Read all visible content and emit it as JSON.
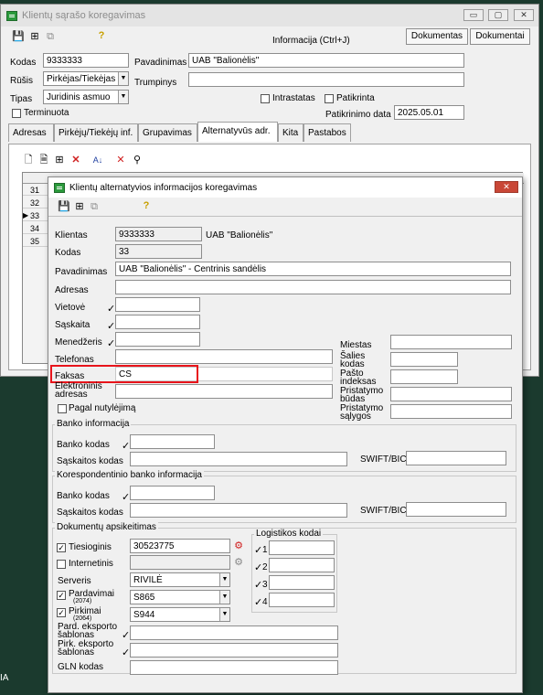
{
  "main": {
    "title": "Klientų sąrašo koregavimas",
    "wbtn_min": "▭",
    "wbtn_max": "▢",
    "wbtn_close": "✕",
    "info_label": "Informacija (Ctrl+J)",
    "btn_documents": "Dokumentas",
    "btn_documents2": "Dokumentai",
    "kodas_label": "Kodas",
    "kodas_value": "9333333",
    "pavadinimas_label": "Pavadinimas",
    "pavadinimas_value": "UAB \"Balionėlis\"",
    "rusis_label": "Rūšis",
    "rusis_value": "Pirkėjas/Tiekėjas",
    "trumpinys_label": "Trumpinys",
    "trumpinys_value": "",
    "tipas_label": "Tipas",
    "tipas_value": "Juridinis asmuo",
    "intrastatas_label": "Intrastatas",
    "patikrinta_label": "Patikrinta",
    "terminuota_label": "Terminuota",
    "patikrinimo_label": "Patikrinimo data",
    "patikrinimo_value": "2025.05.01",
    "tabs": [
      "Adresas",
      "Pirkėjų/Tiekėjų inf.",
      "Grupavimas",
      "Alternatyvūs adr.",
      "Kita",
      "Pastabos"
    ],
    "grid_rows": [
      "31",
      "32",
      "33",
      "34",
      "35"
    ],
    "grid_pointer": "▶"
  },
  "dialog": {
    "title": "Klientų alternatyvios informacijos koregavimas",
    "close": "✕",
    "klientas_label": "Klientas",
    "klientas_value": "9333333",
    "klientas_name": "UAB \"Balionėlis\"",
    "kodas_label": "Kodas",
    "kodas_value": "33",
    "pavadinimas_label": "Pavadinimas",
    "pavadinimas_value": "UAB \"Balionėlis\" - Centrinis sandėlis",
    "adresas_label": "Adresas",
    "vietove_label": "Vietovė",
    "saskaita_label": "Sąskaita",
    "menedzeris_label": "Menedžeris",
    "telefonas_label": "Telefonas",
    "faksas_label": "Faksas",
    "faksas_value": "CS",
    "email_label1": "Elektroninis",
    "email_label2": "adresas",
    "pagal_label": "Pagal nutylėjimą",
    "miestas_label": "Miestas",
    "salies_label1": "Šalies",
    "salies_label2": "kodas",
    "pasto_label1": "Pašto",
    "pasto_label2": "indeksas",
    "pristatymo_budas1": "Pristatymo",
    "pristatymo_budas2": "būdas",
    "pristatymo_salygos1": "Pristatymo",
    "pristatymo_salygos2": "sąlygos",
    "banko_group": "Banko informacija",
    "banko_kodas_label": "Banko kodas",
    "saskaitos_kodas_label": "Sąskaitos kodas",
    "swift_label": "SWIFT/BIC",
    "koresp_group": "Korespondentinio banko informacija",
    "doc_group": "Dokumentų apsikeitimas",
    "tiesioginis_label": "Tiesioginis",
    "tiesioginis_value": "30523775",
    "internetinis_label": "Internetinis",
    "serveris_label": "Serveris",
    "serveris_value": "RIVILĖ",
    "pardavimai_label": "Pardavimai",
    "pardavimai_sub": "(2074)",
    "pardavimai_value": "S865",
    "pirkimai_label": "Pirkimai",
    "pirkimai_sub": "(2064)",
    "pirkimai_value": "S944",
    "pard_eksp1": "Pard. eksporto",
    "pard_eksp2": "šablonas",
    "pirk_eksp1": "Pirk. eksporto",
    "pirk_eksp2": "šablonas",
    "gln_label": "GLN kodas",
    "logist_group": "Logistikos kodai",
    "logist_nums": [
      "1",
      "2",
      "3",
      "4"
    ],
    "tick": "✓",
    "check": "✓",
    "arrow": "▼"
  },
  "taskbar_text": "IA",
  "colors": {
    "highlight": "#e8141b",
    "title_green": "#2b9a3c",
    "close_red": "#c94737"
  }
}
